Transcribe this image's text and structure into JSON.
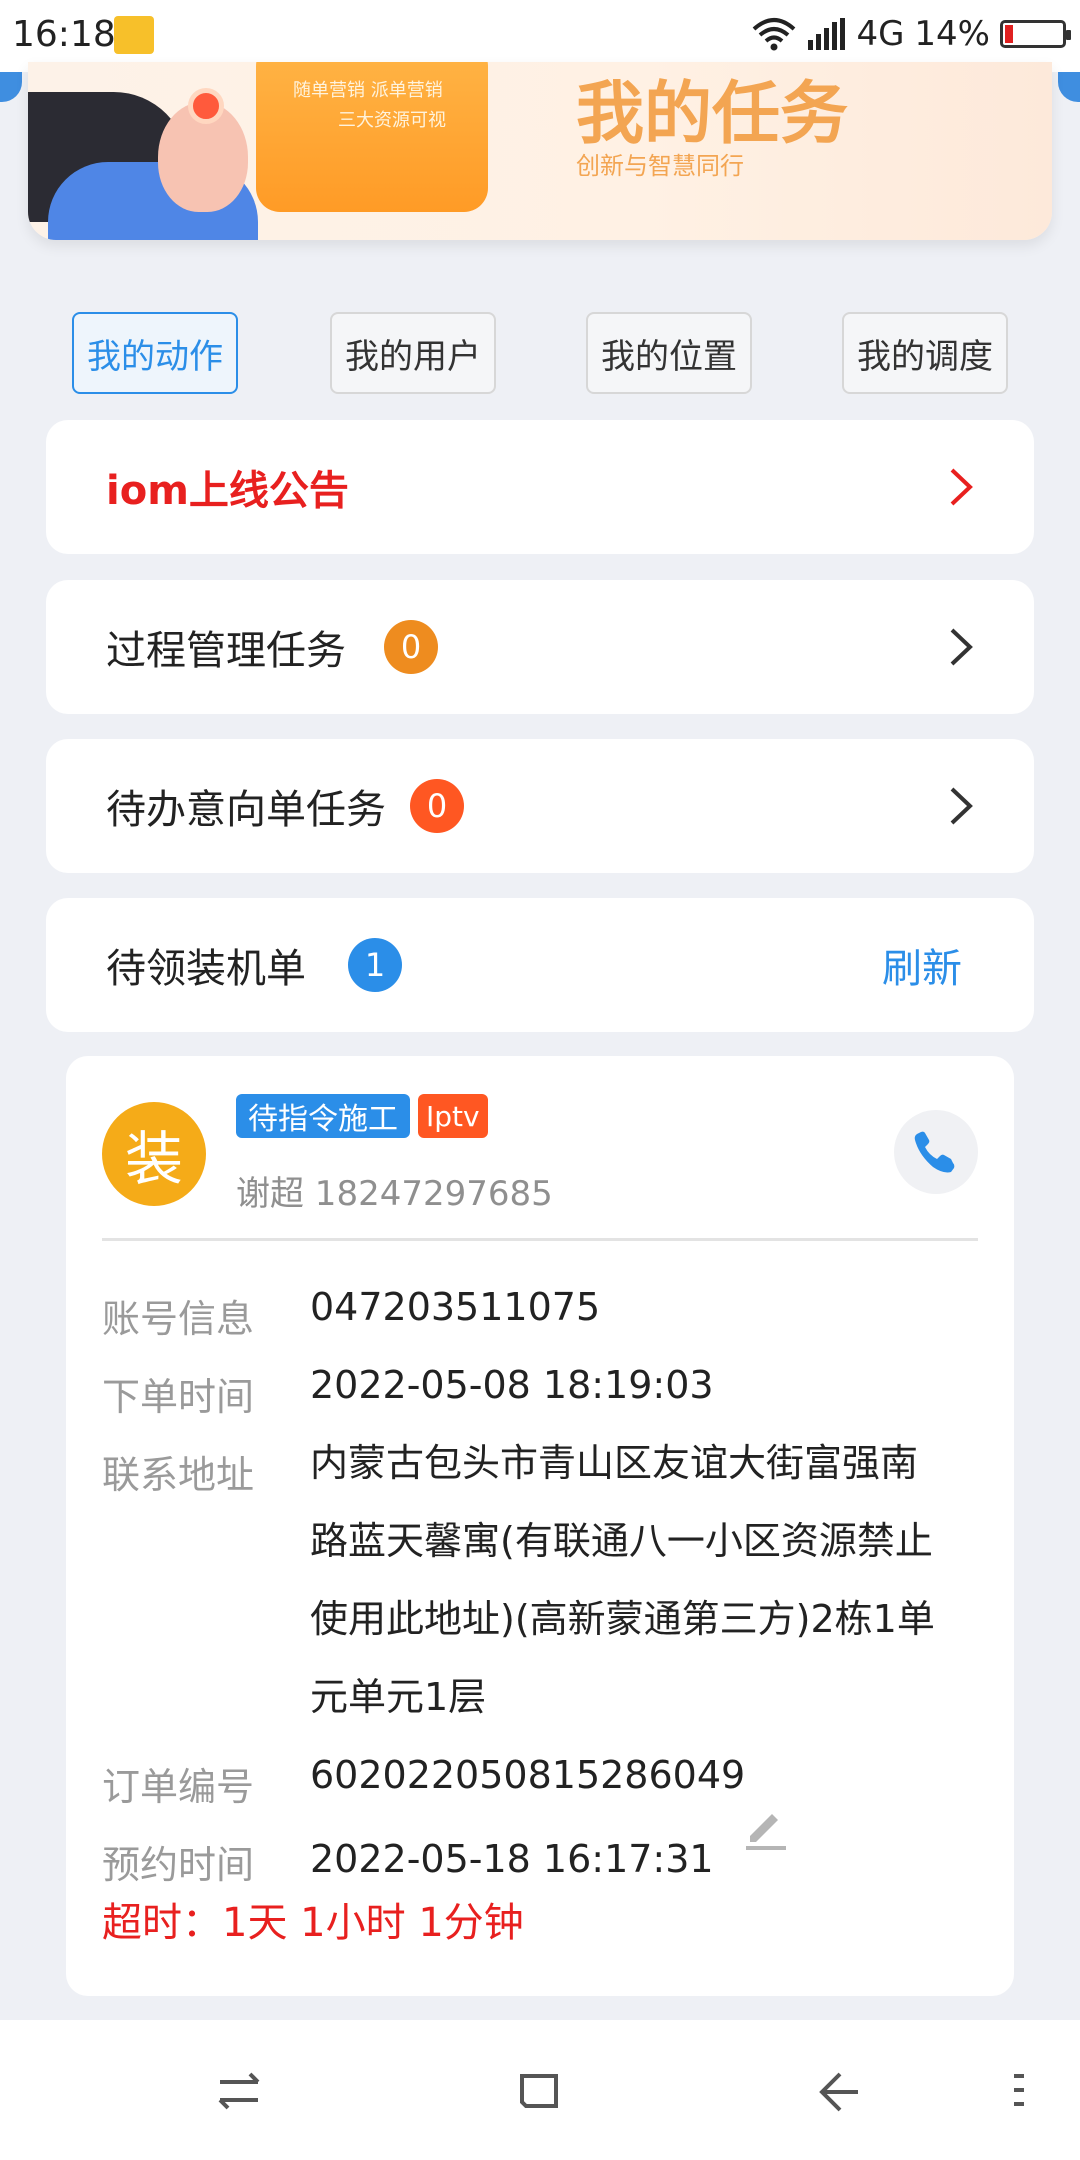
{
  "status_bar": {
    "time": "16:18",
    "network": "4G",
    "battery": "14%",
    "icons": [
      "folder-icon",
      "wifi-icon",
      "signal-icon",
      "battery-icon"
    ]
  },
  "banner": {
    "title": "我的任务",
    "subtitle": "创新与智慧同行",
    "board_line1": "随单营销 派单营销",
    "board_line2": "三大资源可视"
  },
  "tabs": [
    {
      "label": "我的动作",
      "active": true
    },
    {
      "label": "我的用户",
      "active": false
    },
    {
      "label": "我的位置",
      "active": false
    },
    {
      "label": "我的调度",
      "active": false
    }
  ],
  "cards": {
    "announcement": {
      "title": "iom上线公告"
    },
    "process_tasks": {
      "title": "过程管理任务",
      "count": "0",
      "badge_color": "#ee8c1f"
    },
    "intent_tasks": {
      "title": "待办意向单任务",
      "count": "0",
      "badge_color": "#ff5722"
    },
    "pending_install": {
      "title": "待领装机单",
      "count": "1",
      "badge_color": "#2b8ee8",
      "refresh_label": "刷新"
    }
  },
  "order": {
    "avatar_char": "装",
    "status_tag": "待指令施工",
    "service_tag": "Iptv",
    "contact": "谢超 18247297685",
    "rows": {
      "account": {
        "label": "账号信息",
        "value": "047203511075"
      },
      "order_time": {
        "label": "下单时间",
        "value": "2022-05-08 18:19:03"
      },
      "address": {
        "label": "联系地址",
        "value": "内蒙古包头市青山区友谊大街富强南路蓝天馨寓(有联通八一小区资源禁止使用此地址)(高新蒙通第三方)2栋1单元单元1层"
      },
      "order_no": {
        "label": "订单编号",
        "value": "602022050815286049"
      },
      "appointment": {
        "label": "预约时间",
        "value": "2022-05-18 16:17:31"
      }
    },
    "overtime": "超时：1天 1小时 1分钟"
  },
  "colors": {
    "accent": "#2b8ee8",
    "alert": "#e8201f",
    "avatar": "#f5ab18"
  }
}
